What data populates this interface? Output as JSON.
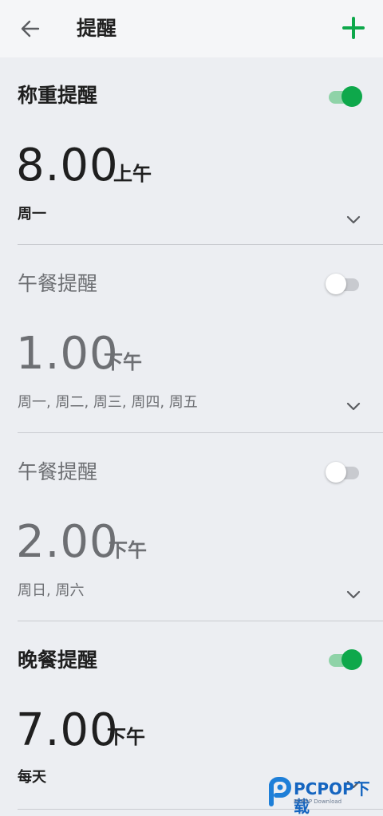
{
  "appbar": {
    "title": "提醒"
  },
  "reminders": [
    {
      "name": "称重提醒",
      "enabled": true,
      "time": "8.00",
      "ampm": "上午",
      "days": "周一"
    },
    {
      "name": "午餐提醒",
      "enabled": false,
      "time": "1.00",
      "ampm": "下午",
      "days": "周一, 周二, 周三, 周四, 周五"
    },
    {
      "name": "午餐提醒",
      "enabled": false,
      "time": "2.00",
      "ampm": "下午",
      "days": "周日, 周六"
    },
    {
      "name": "晚餐提醒",
      "enabled": true,
      "time": "7.00",
      "ampm": "下午",
      "days": "每天"
    }
  ],
  "watermark": {
    "text": "PCPOP下载",
    "sub": "PCPOP Download"
  },
  "colors": {
    "accent": "#0ea84b",
    "toggle_on_track": "#8fd3a8",
    "toggle_off_track": "#c8cacf"
  },
  "icons": {
    "back": "arrow-left-icon",
    "add": "plus-icon",
    "expand": "chevron-down-icon"
  }
}
